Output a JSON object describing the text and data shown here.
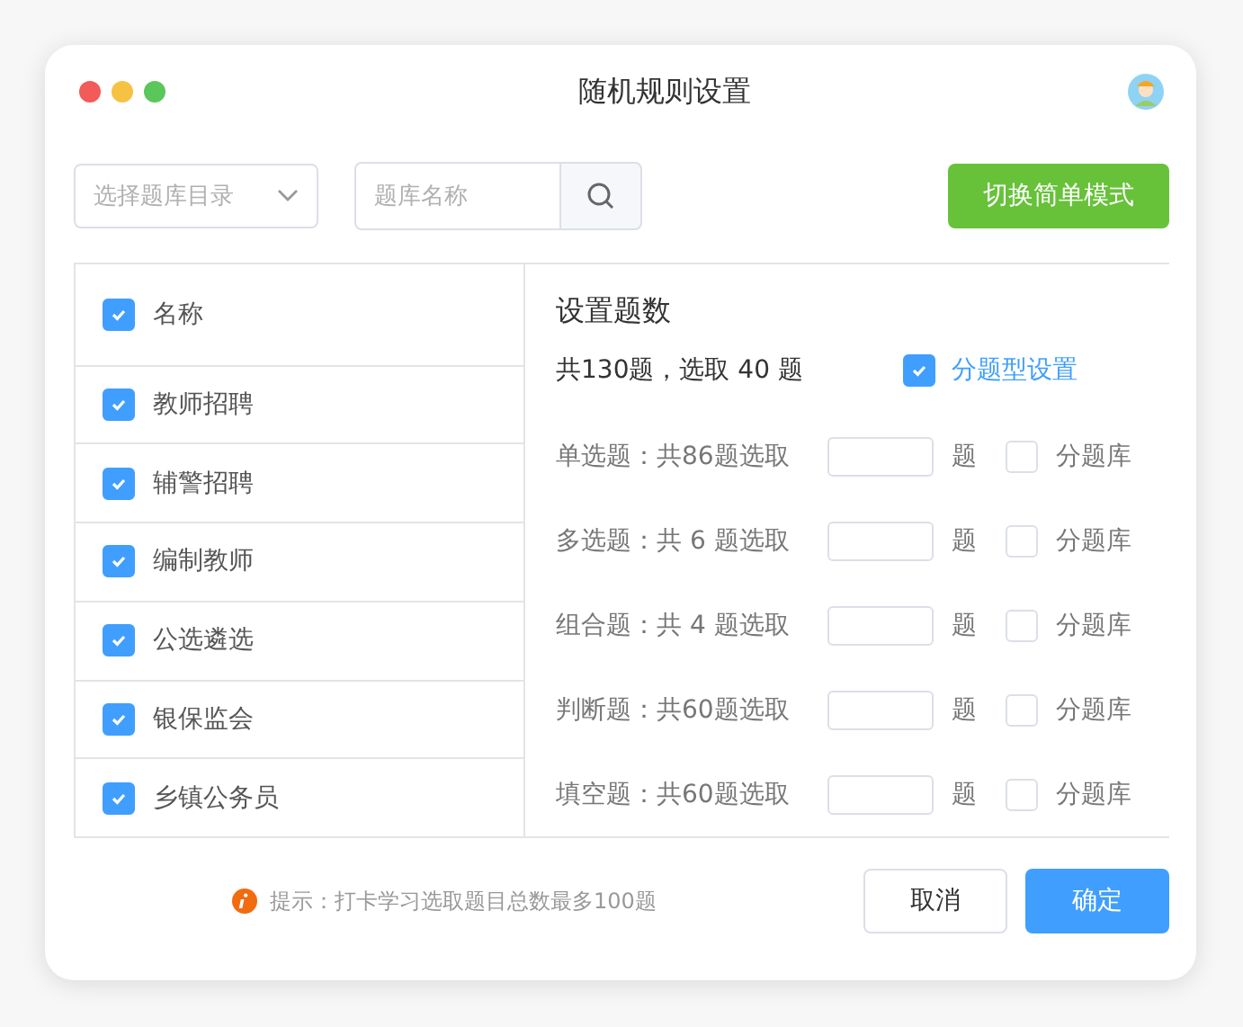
{
  "window": {
    "title": "随机规则设置"
  },
  "toolbar": {
    "category_select": {
      "placeholder": "选择题库目录"
    },
    "search": {
      "placeholder": "题库名称"
    },
    "switch_button": "切换简单模式"
  },
  "bank_list": {
    "header": {
      "label": "名称",
      "checked": true
    },
    "items": [
      {
        "label": "教师招聘",
        "checked": true
      },
      {
        "label": "辅警招聘",
        "checked": true
      },
      {
        "label": "编制教师",
        "checked": true
      },
      {
        "label": "公选遴选",
        "checked": true
      },
      {
        "label": "银保监会",
        "checked": true
      },
      {
        "label": "乡镇公务员",
        "checked": true
      }
    ]
  },
  "settings": {
    "title": "设置题数",
    "summary": "共130题，选取 40 题",
    "by_type": {
      "label": "分题型设置",
      "checked": true
    },
    "types": [
      {
        "label": "单选题：共86题选取",
        "unit": "题",
        "split_label": "分题库",
        "checked": false
      },
      {
        "label": "多选题：共 6 题选取",
        "unit": "题",
        "split_label": "分题库",
        "checked": false
      },
      {
        "label": "组合题：共 4 题选取",
        "unit": "题",
        "split_label": "分题库",
        "checked": false
      },
      {
        "label": "判断题：共60题选取",
        "unit": "题",
        "split_label": "分题库",
        "checked": false
      },
      {
        "label": "填空题：共60题选取",
        "unit": "题",
        "split_label": "分题库",
        "checked": false
      }
    ]
  },
  "footer": {
    "hint": "提示：打卡学习选取题目总数最多100题",
    "buttons": [
      "取消",
      "确定"
    ]
  }
}
